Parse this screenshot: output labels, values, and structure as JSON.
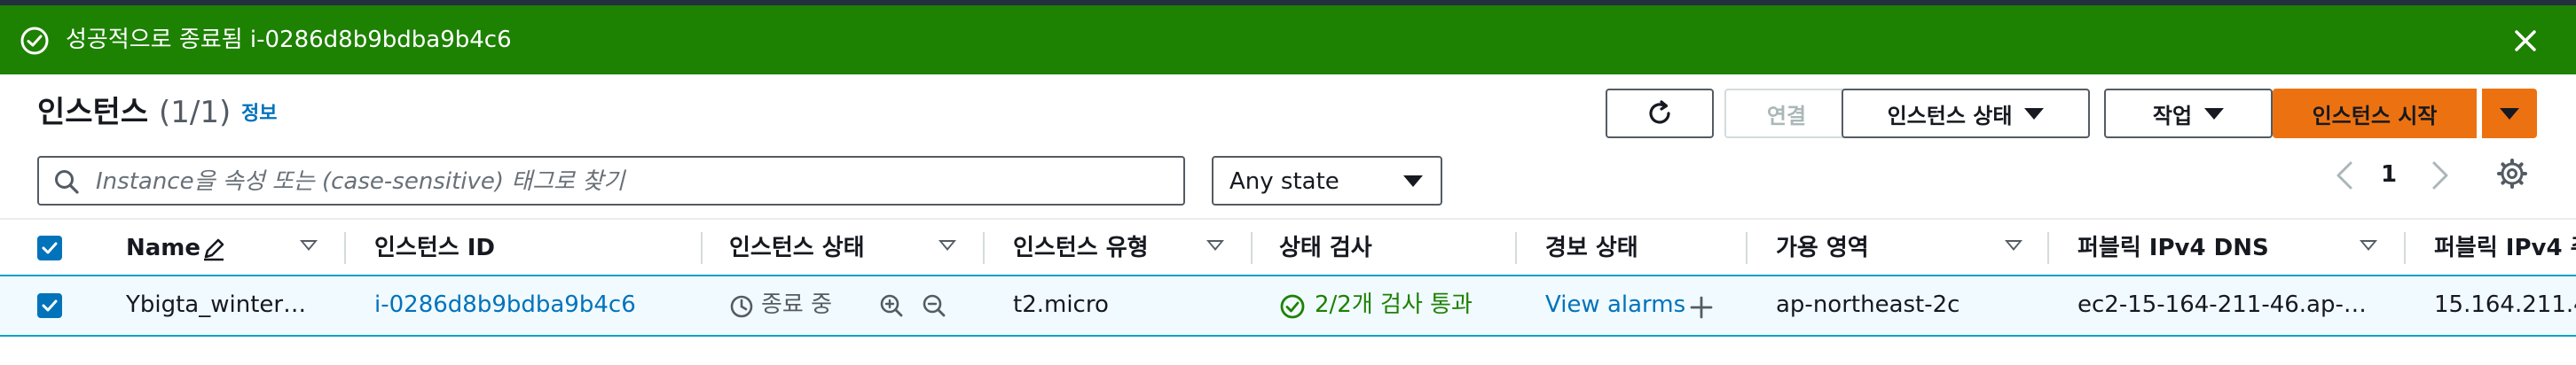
{
  "flash": {
    "message": "성공적으로 종료됨 i-0286d8b9bdba9b4c6",
    "icon": "check-circle-icon",
    "close_icon": "close-icon",
    "background": "#1d8102"
  },
  "header": {
    "title": "인스턴스",
    "count": "(1/1)",
    "info": "정보"
  },
  "toolbar": {
    "refresh_icon": "refresh-icon",
    "connect_label": "연결",
    "instance_state_label": "인스턴스 상태",
    "actions_label": "작업",
    "launch_label": "인스턴스 시작",
    "accent": "#ec7211"
  },
  "filter": {
    "search_placeholder": "Instance을 속성 또는 (case-sensitive) 태그로 찾기",
    "state_value": "Any state"
  },
  "pagination": {
    "page": "1"
  },
  "table": {
    "columns": [
      "Name",
      "인스턴스 ID",
      "인스턴스 상태",
      "인스턴스 유형",
      "상태 검사",
      "경보 상태",
      "가용 영역",
      "퍼블릭 IPv4 DNS",
      "퍼블릭 IPv4 주"
    ],
    "rows": [
      {
        "name": "Ybigta_winter…",
        "instance_id": "i-0286d8b9bdba9b4c6",
        "state": "종료 중",
        "type": "t2.micro",
        "status_check": "2/2개 검사 통과",
        "alarm": "View alarms",
        "az": "ap-northeast-2c",
        "dns": "ec2-15-164-211-46.ap-…",
        "ipv4": "15.164.211.4"
      }
    ]
  }
}
